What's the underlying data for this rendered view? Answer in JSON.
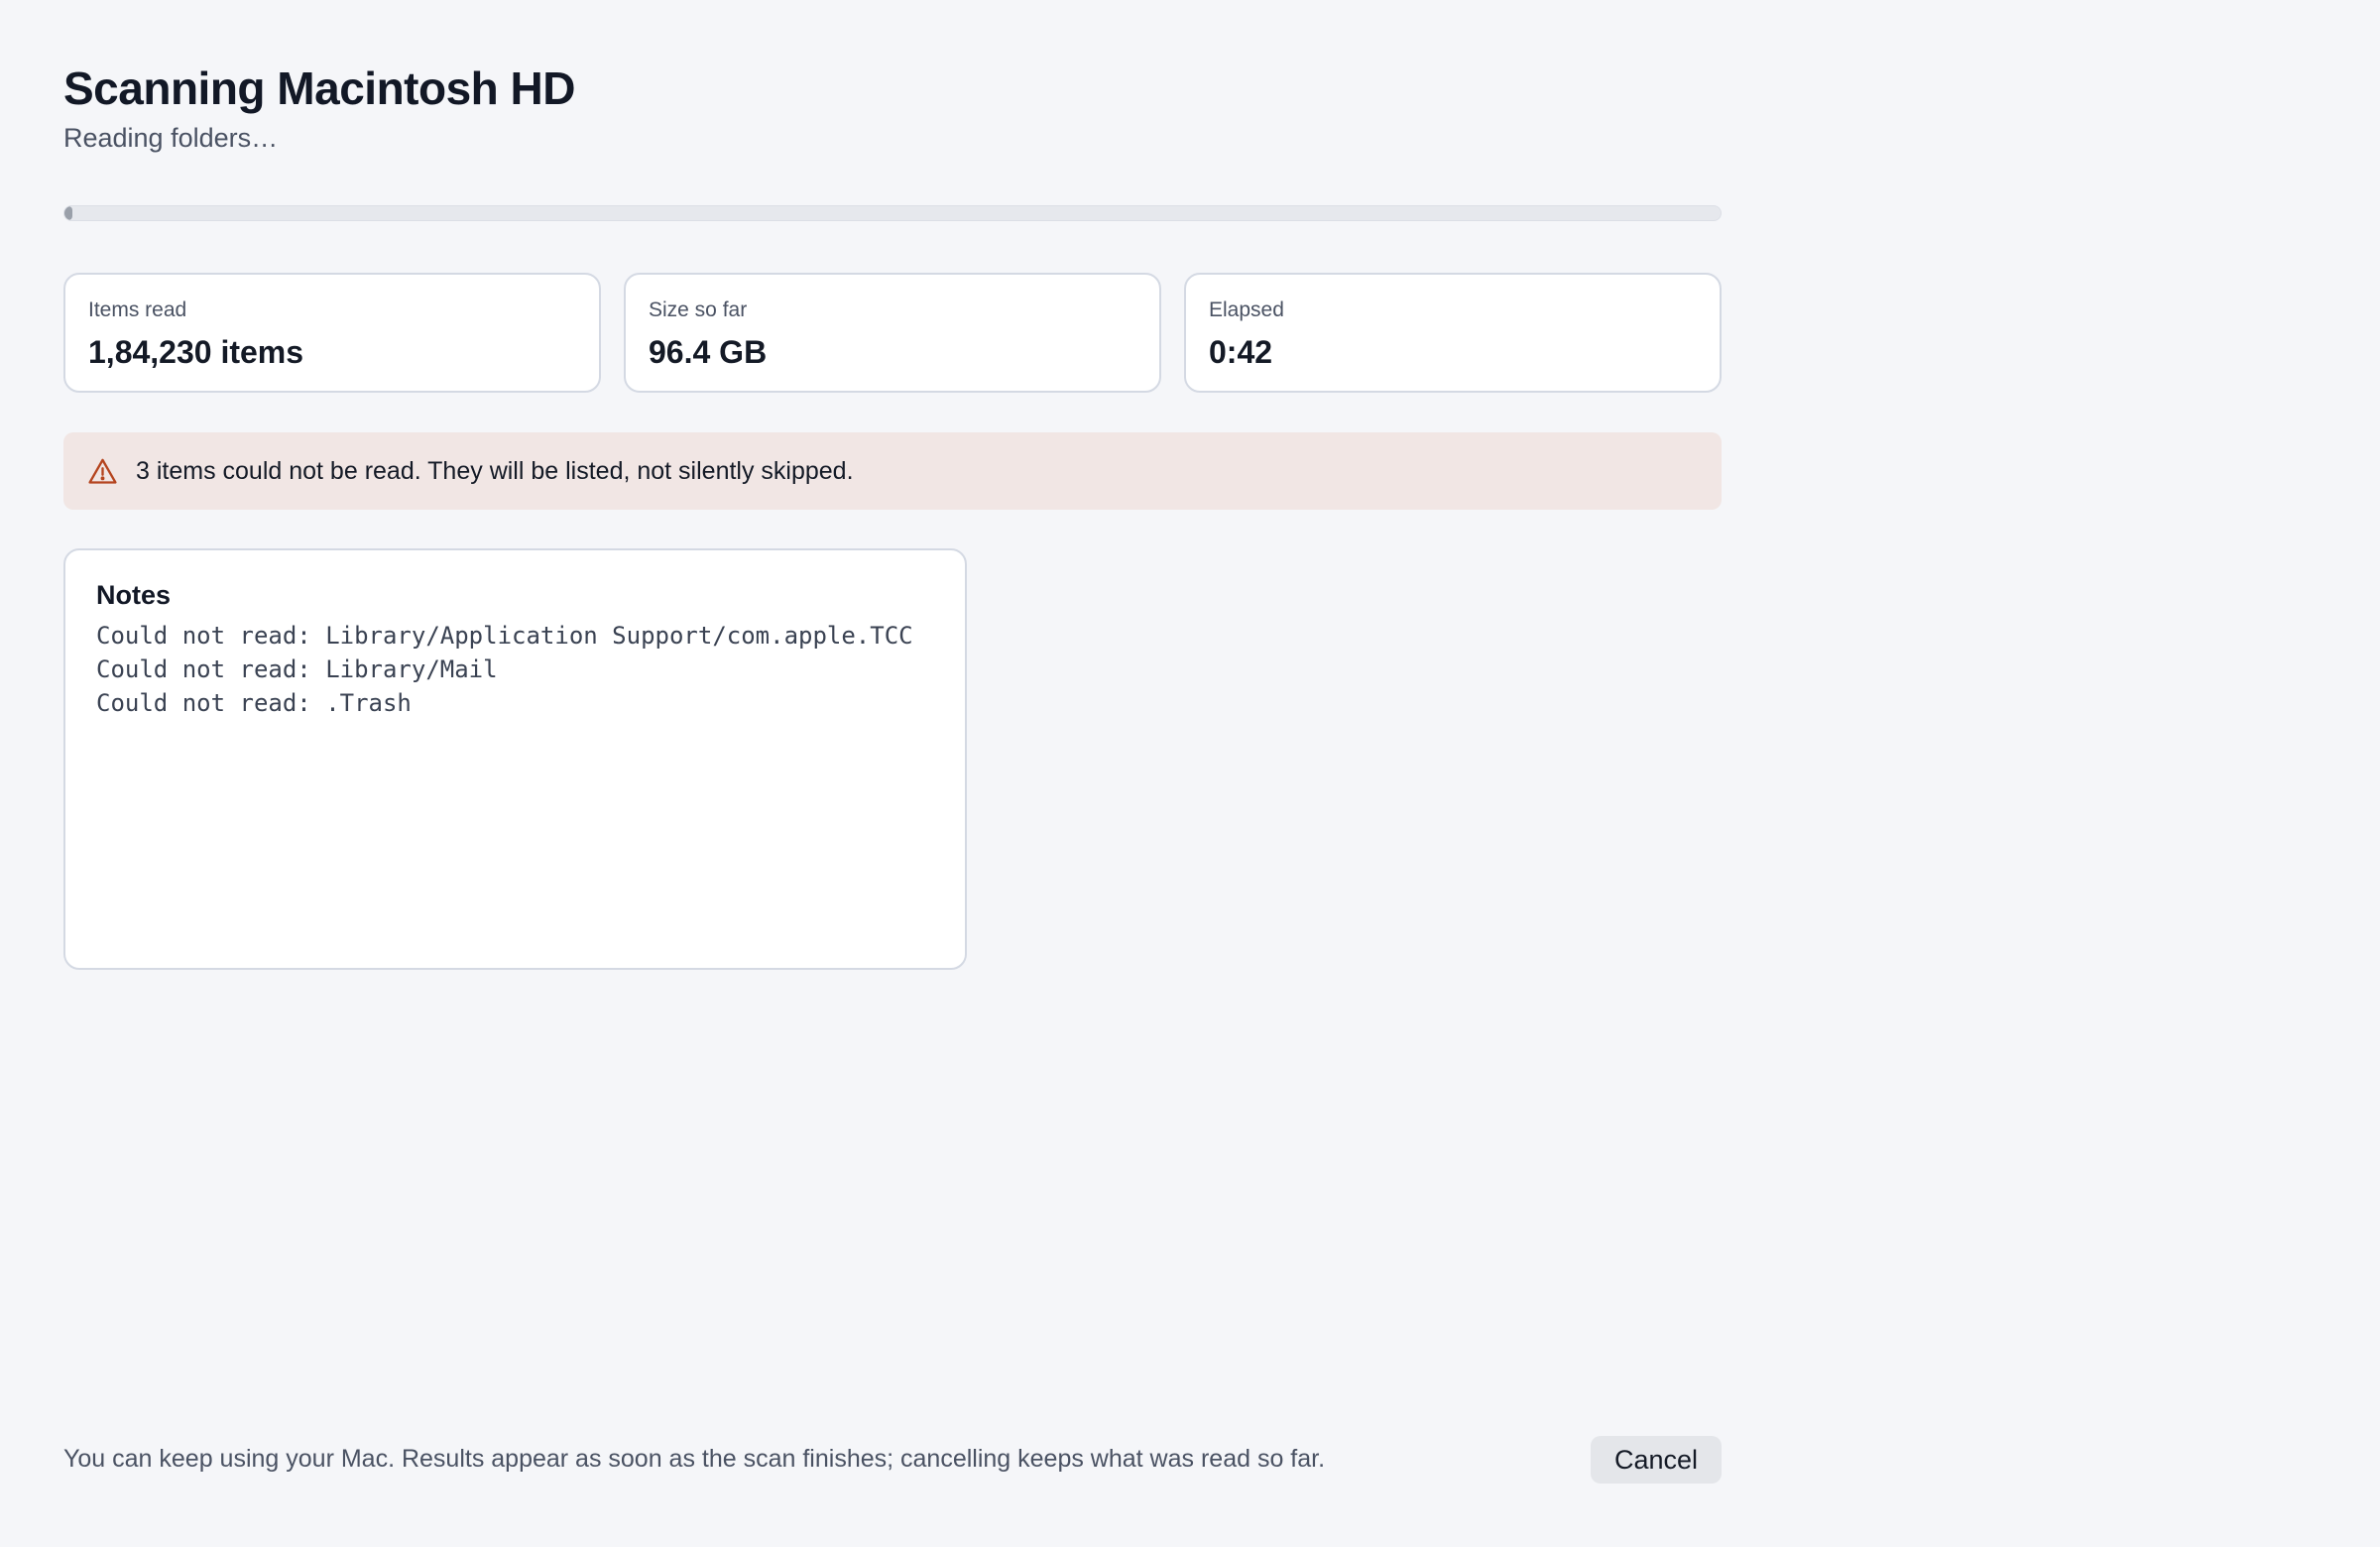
{
  "header": {
    "title": "Scanning Macintosh HD",
    "subtitle": "Reading folders…"
  },
  "progress": {
    "fraction": 0.005
  },
  "stats": [
    {
      "label": "Items read",
      "value": "1,84,230 items"
    },
    {
      "label": "Size so far",
      "value": "96.4 GB"
    },
    {
      "label": "Elapsed",
      "value": "0:42"
    }
  ],
  "warning": {
    "icon": "warning-triangle-icon",
    "text": "3 items could not be read. They will be listed, not silently skipped.",
    "color": "#b5441e",
    "background": "#f1e6e4"
  },
  "notes": {
    "title": "Notes",
    "lines": [
      "Could not read: Library/Application Support/com.apple.TCC",
      "Could not read: Library/Mail",
      "Could not read: .Trash"
    ]
  },
  "footer": {
    "text": "You can keep using your Mac. Results appear as soon as the scan finishes; cancelling keeps what was read so far.",
    "cancel_label": "Cancel"
  }
}
